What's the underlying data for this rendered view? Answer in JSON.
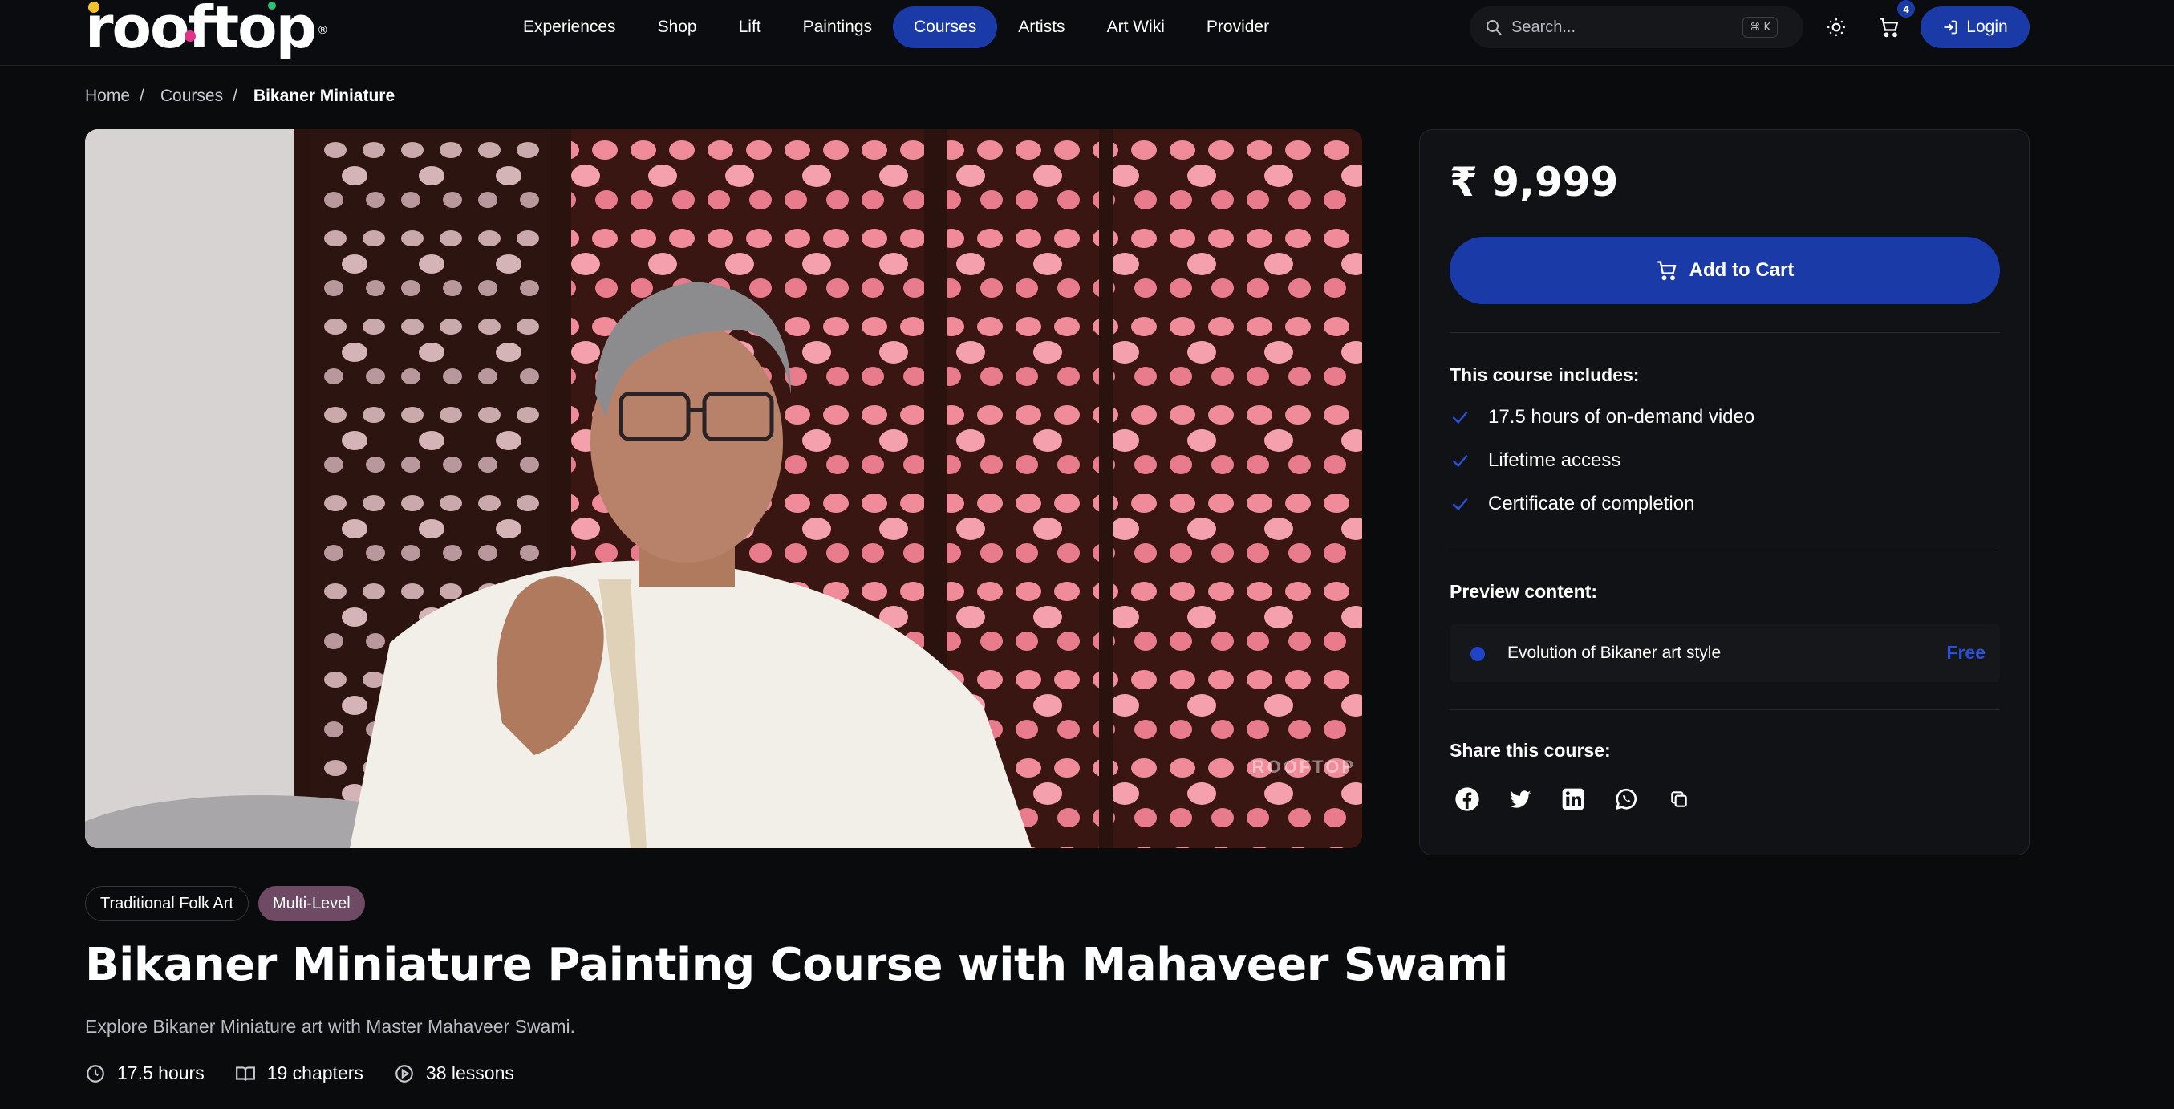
{
  "header": {
    "logo_text": "rooftop",
    "logo_reg": "®",
    "nav": [
      {
        "label": "Experiences",
        "active": false
      },
      {
        "label": "Shop",
        "active": false
      },
      {
        "label": "Lift",
        "active": false
      },
      {
        "label": "Paintings",
        "active": false
      },
      {
        "label": "Courses",
        "active": true
      },
      {
        "label": "Artists",
        "active": false
      },
      {
        "label": "Art Wiki",
        "active": false
      },
      {
        "label": "Provider",
        "active": false
      }
    ],
    "search": {
      "placeholder": "Search...",
      "shortcut": "⌘ K",
      "icon": "search-icon"
    },
    "theme_icon": "sun-icon",
    "cart": {
      "icon": "cart-icon",
      "count": "4"
    },
    "login_label": "Login",
    "login_icon": "login-icon"
  },
  "breadcrumb": {
    "items": [
      "Home",
      "Courses"
    ],
    "separator": "/",
    "current": "Bikaner Miniature"
  },
  "video": {
    "watermark": "ROOFTOP"
  },
  "course": {
    "tags": [
      "Traditional Folk Art",
      "Multi-Level"
    ],
    "title": "Bikaner Miniature Painting Course with Mahaveer Swami",
    "description": "Explore Bikaner Miniature art with Master Mahaveer Swami.",
    "stats": [
      {
        "icon": "clock-icon",
        "label": "17.5 hours"
      },
      {
        "icon": "book-icon",
        "label": "19 chapters"
      },
      {
        "icon": "play-circle-icon",
        "label": "38 lessons"
      }
    ]
  },
  "card": {
    "price": "₹ 9,999",
    "add_to_cart": "Add to Cart",
    "includes_label": "This course includes:",
    "includes": [
      "17.5 hours of on-demand video",
      "Lifetime access",
      "Certificate of completion"
    ],
    "preview_label": "Preview content:",
    "preview_item": {
      "title": "Evolution of Bikaner art style",
      "badge": "Free"
    },
    "share_label": "Share this course:",
    "share": [
      "facebook-icon",
      "twitter-icon",
      "linkedin-icon",
      "whatsapp-icon",
      "copy-icon"
    ]
  },
  "colors": {
    "accent": "#1a3aa8",
    "background": "#0a0b0d",
    "card": "#111215",
    "tag_level": "#6e4a64",
    "free": "#2a50d8"
  }
}
